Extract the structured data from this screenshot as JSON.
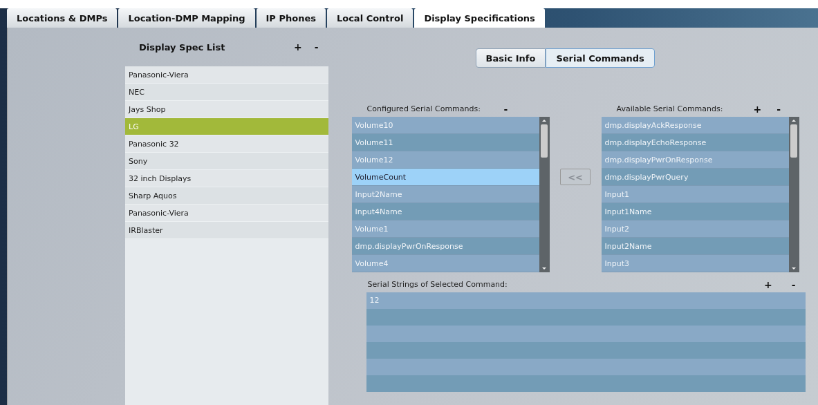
{
  "tabs": [
    {
      "label": "Locations & DMPs",
      "selected": false
    },
    {
      "label": "Location-DMP Mapping",
      "selected": false
    },
    {
      "label": "IP Phones",
      "selected": false
    },
    {
      "label": "Local Control",
      "selected": false
    },
    {
      "label": "Display Specifications",
      "selected": true
    }
  ],
  "spec_list": {
    "title": "Display Spec List",
    "add": "+",
    "remove": "-",
    "items": [
      {
        "label": "Panasonic-Viera",
        "selected": false
      },
      {
        "label": "NEC",
        "selected": false
      },
      {
        "label": "Jays Shop",
        "selected": false
      },
      {
        "label": "LG",
        "selected": true
      },
      {
        "label": "Panasonic 32",
        "selected": false
      },
      {
        "label": "Sony",
        "selected": false
      },
      {
        "label": "32 inch Displays",
        "selected": false
      },
      {
        "label": "Sharp Aquos",
        "selected": false
      },
      {
        "label": "Panasonic-Viera",
        "selected": false
      },
      {
        "label": "IRBlaster",
        "selected": false
      }
    ]
  },
  "view_toggle": [
    {
      "label": "Basic Info",
      "selected": false
    },
    {
      "label": "Serial Commands",
      "selected": true
    }
  ],
  "configured_commands": {
    "title": "Configured Serial Commands:",
    "remove": "-",
    "items": [
      {
        "label": "Volume10",
        "selected": false
      },
      {
        "label": "Volume11",
        "selected": false
      },
      {
        "label": "Volume12",
        "selected": false
      },
      {
        "label": "VolumeCount",
        "selected": true
      },
      {
        "label": "Input2Name",
        "selected": false
      },
      {
        "label": "Input4Name",
        "selected": false
      },
      {
        "label": "Volume1",
        "selected": false
      },
      {
        "label": "dmp.displayPwrOnResponse",
        "selected": false
      },
      {
        "label": "Volume4",
        "selected": false
      }
    ]
  },
  "move_button": {
    "label": "<<",
    "disabled": true
  },
  "available_commands": {
    "title": "Available Serial Commands:",
    "add": "+",
    "remove": "-",
    "items": [
      {
        "label": "dmp.displayAckResponse",
        "selected": false
      },
      {
        "label": "dmp.displayEchoResponse",
        "selected": false
      },
      {
        "label": "dmp.displayPwrOnResponse",
        "selected": false
      },
      {
        "label": "dmp.displayPwrQuery",
        "selected": false
      },
      {
        "label": "Input1",
        "selected": false
      },
      {
        "label": "Input1Name",
        "selected": false
      },
      {
        "label": "Input2",
        "selected": false
      },
      {
        "label": "Input2Name",
        "selected": false
      },
      {
        "label": "Input3",
        "selected": false
      }
    ]
  },
  "serial_strings": {
    "title": "Serial Strings of Selected Command:",
    "add": "+",
    "remove": "-",
    "rows": [
      "12",
      "",
      "",
      "",
      "",
      ""
    ]
  }
}
